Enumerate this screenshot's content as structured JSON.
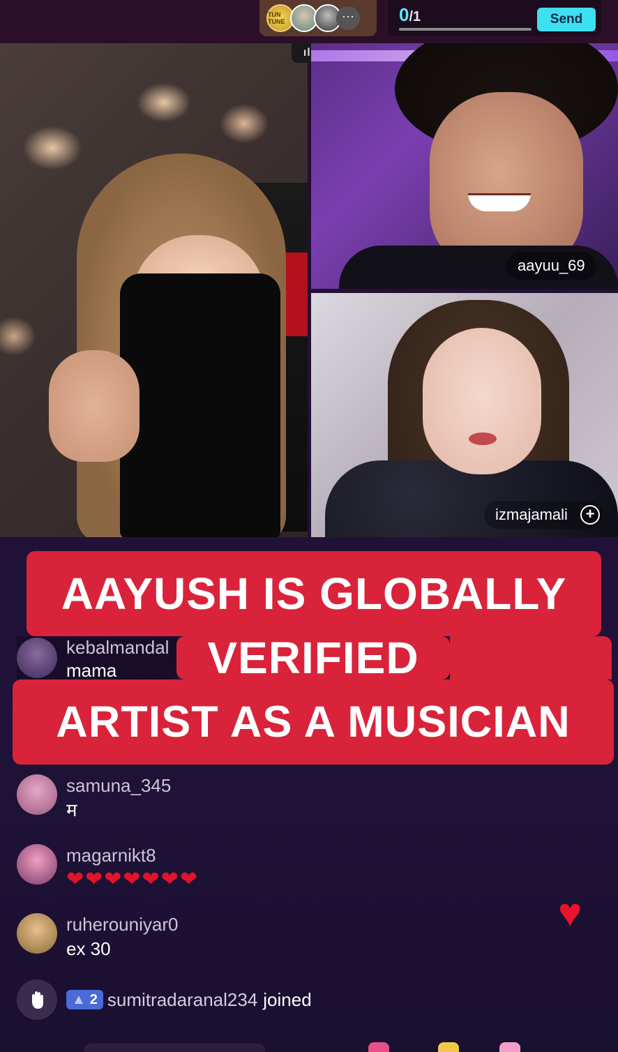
{
  "top_bar": {
    "viewer_badge_text": "TUN TUNE",
    "more_label": "···",
    "goal_current": "0",
    "goal_total": "/1",
    "goal_progress": 0,
    "send_label": "Send"
  },
  "videos": {
    "live_indicator": "ılı",
    "guest1_name": "aayuu_69",
    "guest2_name": "izmajamali",
    "follow_symbol": "+"
  },
  "caption": {
    "line1": "AAYUSH IS GLOBALLY",
    "line2": "VERIFIED",
    "line3": "ARTIST AS A MUSICIAN"
  },
  "chat": {
    "messages": [
      {
        "user": "kebalmandal",
        "text": "mama"
      },
      {
        "user": "samuna_345",
        "text": "म"
      },
      {
        "user": "magarnikt8",
        "text": "❤❤❤❤❤❤❤"
      },
      {
        "user": "ruherouniyar0",
        "text": "ex 30"
      }
    ],
    "join_event": {
      "level": "2",
      "user": "sumitradaranal234",
      "action": "joined"
    }
  },
  "colors": {
    "accent_cyan": "#5ce8ff",
    "caption_red": "#d9233a",
    "heart_red": "#e8142c"
  }
}
